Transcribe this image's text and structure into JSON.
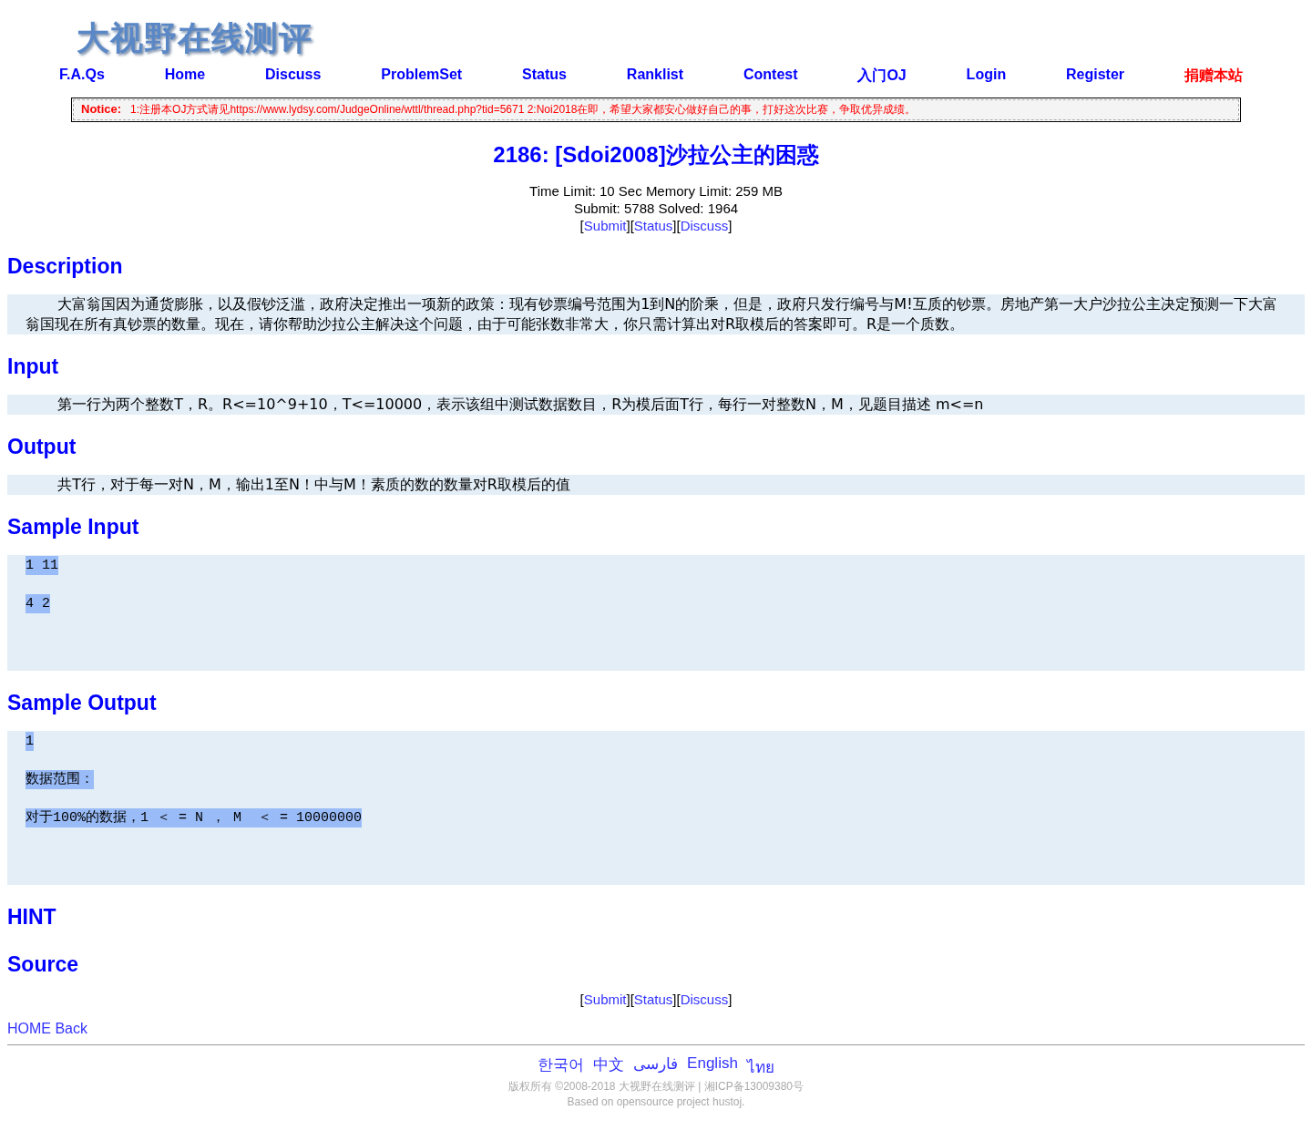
{
  "logo": {
    "text": "大视野在线测评"
  },
  "nav": [
    {
      "label": "F.A.Qs",
      "kind": "normal"
    },
    {
      "label": "Home",
      "kind": "normal"
    },
    {
      "label": "Discuss",
      "kind": "normal"
    },
    {
      "label": "ProblemSet",
      "kind": "normal"
    },
    {
      "label": "Status",
      "kind": "normal"
    },
    {
      "label": "Ranklist",
      "kind": "normal"
    },
    {
      "label": "Contest",
      "kind": "normal"
    },
    {
      "label": "入门OJ",
      "kind": "normal"
    },
    {
      "label": "Login",
      "kind": "normal"
    },
    {
      "label": "Register",
      "kind": "normal"
    },
    {
      "label": "捐赠本站",
      "kind": "donate"
    }
  ],
  "notice": {
    "label": "Notice:",
    "text": "1:注册本OJ方式请见https://www.lydsy.com/JudgeOnline/wttl/thread.php?tid=5671 2:Noi2018在即，希望大家都安心做好自己的事，打好这次比赛，争取优异成绩。"
  },
  "problem": {
    "title": "2186: [Sdoi2008]沙拉公主的困惑",
    "limits": "Time Limit: 10 Sec  Memory Limit: 259 MB",
    "counts": "Submit: 5788  Solved: 1964"
  },
  "links_top": [
    {
      "text": "[",
      "kind": "bracket"
    },
    {
      "text": "Submit",
      "kind": "link"
    },
    {
      "text": "][",
      "kind": "bracket"
    },
    {
      "text": "Status",
      "kind": "link"
    },
    {
      "text": "][",
      "kind": "bracket"
    },
    {
      "text": "Discuss",
      "kind": "link"
    },
    {
      "text": "]",
      "kind": "bracket"
    }
  ],
  "sections": [
    {
      "heading": "Description",
      "kind": "text",
      "body": "大富翁国因为通货膨胀，以及假钞泛滥，政府决定推出一项新的政策：现有钞票编号范围为1到N的阶乘，但是，政府只发行编号与M!互质的钞票。房地产第一大户沙拉公主决定预测一下大富翁国现在所有真钞票的数量。现在，请你帮助沙拉公主解决这个问题，由于可能张数非常大，你只需计算出对R取模后的答案即可。R是一个质数。"
    },
    {
      "heading": "Input",
      "kind": "text",
      "body": "第一行为两个整数T，R。R<=10^9+10，T<=10000，表示该组中测试数据数目，R为模后面T行，每行一对整数N，M，见题目描述 m<=n"
    },
    {
      "heading": "Output",
      "kind": "text",
      "body": "共T行，对于每一对N，M，输出1至N！中与M！素质的数的数量对R取模后的值"
    },
    {
      "heading": "Sample Input",
      "kind": "sample",
      "lines": [
        {
          "text": "1 11",
          "selected": true
        },
        {
          "text": "4 2",
          "selected": true
        }
      ]
    },
    {
      "heading": "Sample Output",
      "kind": "sample",
      "lines": [
        {
          "text": "1",
          "selected": true
        },
        {
          "text": "数据范围：",
          "selected": true
        },
        {
          "text": "对于100%的数据，1 ＜ = N ， M  ＜ = 10000000",
          "selected": true
        }
      ]
    },
    {
      "heading": "HINT",
      "kind": "empty"
    },
    {
      "heading": "Source",
      "kind": "empty"
    }
  ],
  "links_bottom": [
    {
      "text": "[",
      "kind": "bracket"
    },
    {
      "text": "Submit",
      "kind": "link"
    },
    {
      "text": "][",
      "kind": "bracket"
    },
    {
      "text": "Status",
      "kind": "link"
    },
    {
      "text": "][",
      "kind": "bracket"
    },
    {
      "text": "Discuss",
      "kind": "link"
    },
    {
      "text": "]",
      "kind": "bracket"
    }
  ],
  "back_links": "HOME Back",
  "languages": [
    "한국어",
    "中文",
    "فارسی",
    "English",
    "ไทย"
  ],
  "copyright": "版权所有 ©2008-2018 大视野在线测评 | 湘ICP备13009380号",
  "based_on": "Based on opensource project hustoj."
}
